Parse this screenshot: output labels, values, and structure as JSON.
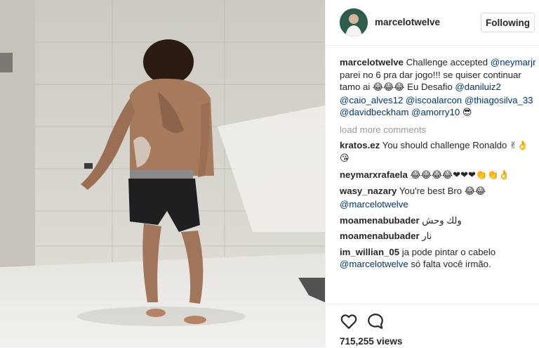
{
  "post": {
    "username": "marcelotwelve",
    "follow_label": "Following",
    "avatar_icon": "profile-avatar",
    "caption": {
      "user": "marcelotwelve",
      "text_1": " Challenge accepted ",
      "mention_1": "@neymarjr",
      "text_2": " parei no 6 pra dar jogo!!! se quiser continuar tamo ai ",
      "emoji_1": "😂😂😂",
      "text_3": " Eu Desafio ",
      "mention_2": "@daniluiz2",
      "mention_3": "@caio_alves12",
      "mention_4": "@iscoalarcon",
      "mention_5": "@thiagosilva_33",
      "mention_6": "@davidbeckham",
      "mention_7": "@amorry10",
      "emoji_2": "😎"
    },
    "load_more": "load more comments",
    "comments": [
      {
        "user": "kratos.ez",
        "text": "You should challenge Ronaldo",
        "emoji": "✌👌😘",
        "mention": ""
      },
      {
        "user": "neymarxrafaela",
        "text": "",
        "emoji": "😂😂😂😂❤❤❤👏👏👌",
        "mention": ""
      },
      {
        "user": "wasy_nazary",
        "text": "You're best Bro",
        "emoji": "😂😂",
        "mention": "@marcelotwelve"
      },
      {
        "user": "moamenabubader",
        "text": "ولك وحش",
        "emoji": "",
        "mention": ""
      },
      {
        "user": "moamenabubader",
        "text": "نار",
        "emoji": "",
        "mention": ""
      },
      {
        "user": "im_willian_05",
        "text": "ja pode pintar o cabelo",
        "emoji": "",
        "mention": "@marcelotwelve",
        "text_after": " só falta você irmão."
      }
    ],
    "views": "715,255 views",
    "icons": {
      "like": "heart-icon",
      "comment": "comment-icon"
    }
  }
}
